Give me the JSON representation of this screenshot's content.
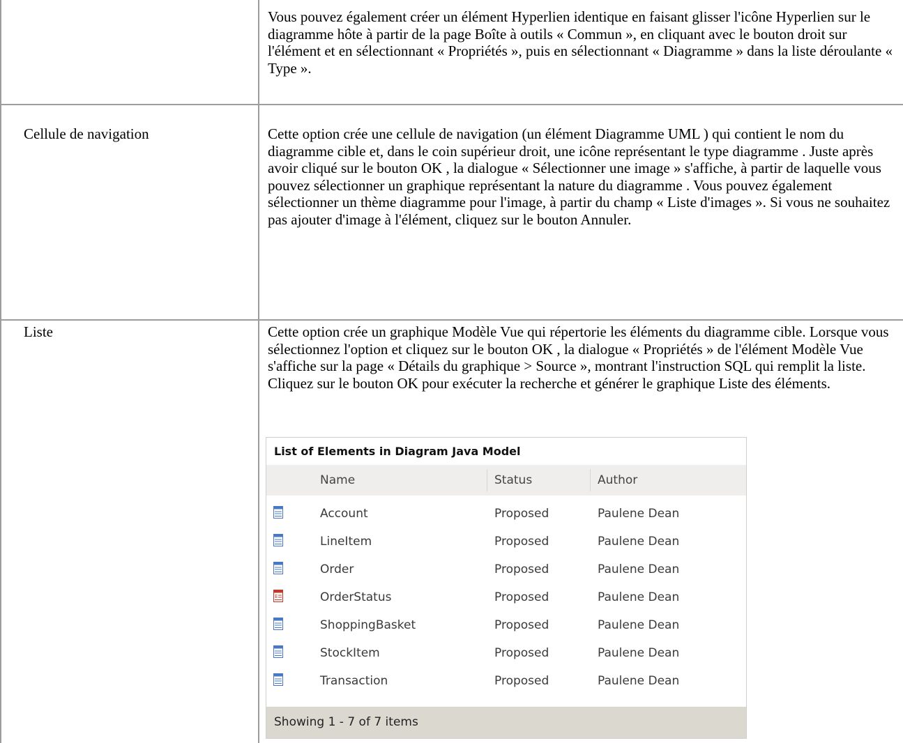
{
  "top_row": {
    "text": "Vous pouvez également créer un élément Hyperlien identique en faisant glisser l'icône Hyperlien sur le diagramme hôte à partir de la page Boîte à outils « Commun », en cliquant avec le bouton droit sur l'élément et en sélectionnant « Propriétés », puis en sélectionnant « Diagramme » dans la liste déroulante « Type »."
  },
  "rows": [
    {
      "label": "Cellule de navigation",
      "text": "Cette option crée une cellule de navigation (un élément Diagramme UML ) qui contient le nom du diagramme cible et, dans le coin supérieur droit, une icône représentant le type diagramme . Juste après avoir cliqué sur le bouton OK , la dialogue « Sélectionner une image » s'affiche, à partir de laquelle vous pouvez sélectionner un graphique représentant la nature du diagramme . Vous pouvez également sélectionner un thème diagramme pour l'image, à partir du champ « Liste d'images ». Si vous ne souhaitez pas ajouter d'image à l'élément, cliquez sur le bouton Annuler."
    },
    {
      "label": "Liste",
      "text": "Cette option crée un graphique Modèle Vue qui répertorie les éléments du diagramme cible. Lorsque vous sélectionnez l'option et cliquez sur le bouton OK , la dialogue « Propriétés » de l'élément Modèle Vue s'affiche sur la page « Détails du graphique > Source », montrant l'instruction SQL qui remplit la liste. Cliquez sur le bouton OK pour exécuter la recherche et générer le graphique Liste des éléments."
    }
  ],
  "list_widget": {
    "title": "List of Elements in Diagram Java Model",
    "columns": [
      "Name",
      "Status",
      "Author"
    ],
    "items": [
      {
        "icon": "class-icon",
        "name": "Account",
        "status": "Proposed",
        "author": "Paulene Dean"
      },
      {
        "icon": "class-icon",
        "name": "LineItem",
        "status": "Proposed",
        "author": "Paulene Dean"
      },
      {
        "icon": "class-icon",
        "name": "Order",
        "status": "Proposed",
        "author": "Paulene Dean"
      },
      {
        "icon": "enumeration-icon",
        "name": "OrderStatus",
        "status": "Proposed",
        "author": "Paulene Dean"
      },
      {
        "icon": "class-icon",
        "name": "ShoppingBasket",
        "status": "Proposed",
        "author": "Paulene Dean"
      },
      {
        "icon": "class-icon",
        "name": "StockItem",
        "status": "Proposed",
        "author": "Paulene Dean"
      },
      {
        "icon": "class-icon",
        "name": "Transaction",
        "status": "Proposed",
        "author": "Paulene Dean"
      }
    ],
    "footer": "Showing 1 - 7 of 7 items"
  },
  "colors": {
    "border": "#9c9c9c",
    "header_bg": "#efeeec",
    "footer_bg": "#dbd8d0",
    "class_icon": "#4a78c2",
    "enum_icon": "#c0392b"
  }
}
